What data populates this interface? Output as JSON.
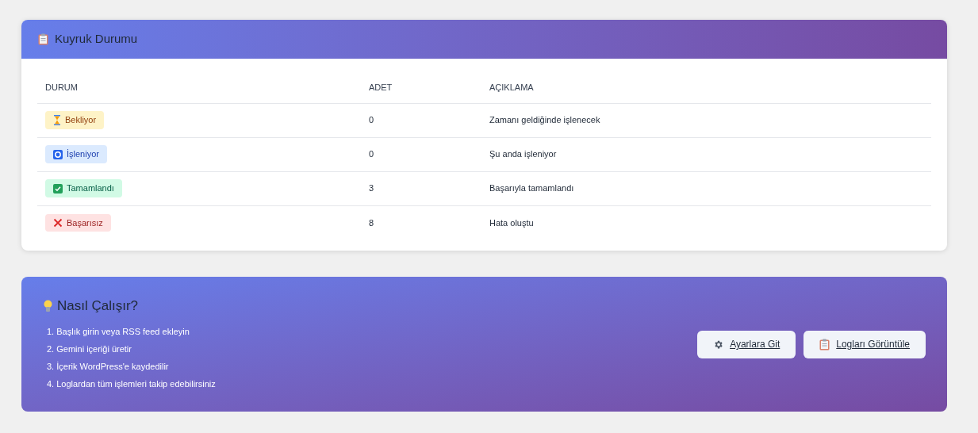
{
  "queue_card": {
    "title": "Kuyruk Durumu",
    "table": {
      "columns": [
        "DURUM",
        "ADET",
        "AÇIKLAMA"
      ],
      "rows": [
        {
          "status": {
            "label": "Bekliyor",
            "kind": "waiting"
          },
          "count": "0",
          "description": "Zamanı geldiğinde işlenecek"
        },
        {
          "status": {
            "label": "İşleniyor",
            "kind": "processing"
          },
          "count": "0",
          "description": "Şu anda işleniyor"
        },
        {
          "status": {
            "label": "Tamamlandı",
            "kind": "done"
          },
          "count": "3",
          "description": "Başarıyla tamamlandı"
        },
        {
          "status": {
            "label": "Başarısız",
            "kind": "failed"
          },
          "count": "8",
          "description": "Hata oluştu"
        }
      ]
    }
  },
  "help_card": {
    "title": "Nasıl Çalışır?",
    "steps": [
      "1. Başlık girin veya RSS feed ekleyin",
      "2. Gemini içeriği üretir",
      "3. İçerik WordPress'e kaydedilir",
      "4. Loglardan tüm işlemleri takip edebilirsiniz"
    ],
    "buttons": [
      {
        "label": "Ayarlara Git",
        "kind": "settings"
      },
      {
        "label": "Logları Görüntüle",
        "kind": "logs"
      }
    ]
  }
}
